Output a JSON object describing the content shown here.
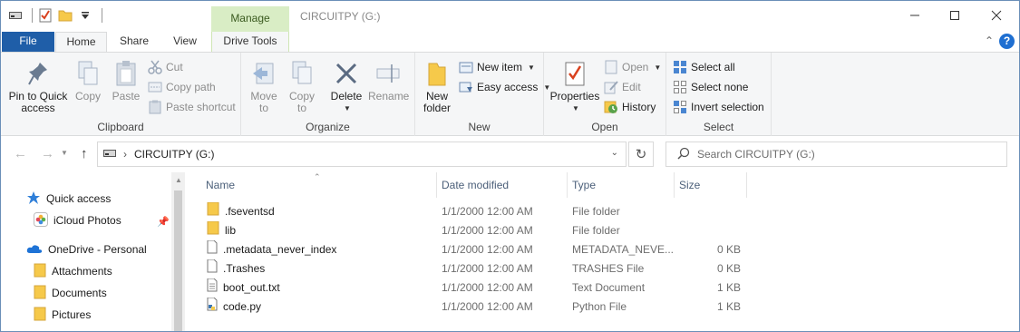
{
  "window": {
    "title": "CIRCUITPY (G:)",
    "context_tab": "Manage"
  },
  "ribbon_tabs": [
    "File",
    "Home",
    "Share",
    "View",
    "Drive Tools"
  ],
  "ribbon": {
    "clipboard": {
      "label": "Clipboard",
      "pin_line1": "Pin to Quick",
      "pin_line2": "access",
      "copy": "Copy",
      "paste": "Paste",
      "cut": "Cut",
      "copy_path": "Copy path",
      "paste_shortcut": "Paste shortcut"
    },
    "organize": {
      "label": "Organize",
      "move_line1": "Move",
      "move_line2": "to",
      "copy_line1": "Copy",
      "copy_line2": "to",
      "delete": "Delete",
      "rename": "Rename"
    },
    "new": {
      "label": "New",
      "new_folder_line1": "New",
      "new_folder_line2": "folder",
      "new_item": "New item",
      "easy_access": "Easy access"
    },
    "open": {
      "label": "Open",
      "properties": "Properties",
      "open": "Open",
      "edit": "Edit",
      "history": "History"
    },
    "select": {
      "label": "Select",
      "select_all": "Select all",
      "select_none": "Select none",
      "invert_selection": "Invert selection"
    }
  },
  "address": {
    "path": "CIRCUITPY (G:)"
  },
  "search": {
    "placeholder": "Search CIRCUITPY (G:)"
  },
  "nav_pane": {
    "quick_access": "Quick access",
    "icloud_photos": "iCloud Photos",
    "onedrive": "OneDrive - Personal",
    "attachments": "Attachments",
    "documents": "Documents",
    "pictures": "Pictures"
  },
  "columns": {
    "name": "Name",
    "date": "Date modified",
    "type": "Type",
    "size": "Size"
  },
  "files": [
    {
      "name": ".fseventsd",
      "date": "1/1/2000 12:00 AM",
      "type": "File folder",
      "size": ""
    },
    {
      "name": "lib",
      "date": "1/1/2000 12:00 AM",
      "type": "File folder",
      "size": ""
    },
    {
      "name": ".metadata_never_index",
      "date": "1/1/2000 12:00 AM",
      "type": "METADATA_NEVE...",
      "size": "0 KB"
    },
    {
      "name": ".Trashes",
      "date": "1/1/2000 12:00 AM",
      "type": "TRASHES File",
      "size": "0 KB"
    },
    {
      "name": "boot_out.txt",
      "date": "1/1/2000 12:00 AM",
      "type": "Text Document",
      "size": "1 KB"
    },
    {
      "name": "code.py",
      "date": "1/1/2000 12:00 AM",
      "type": "Python File",
      "size": "1 KB"
    }
  ],
  "colors": {
    "file_tab": "#1f5ea8",
    "manage_tab": "#d9edc5",
    "folder": "#f6c94a",
    "accent": "#1f6fd1"
  }
}
